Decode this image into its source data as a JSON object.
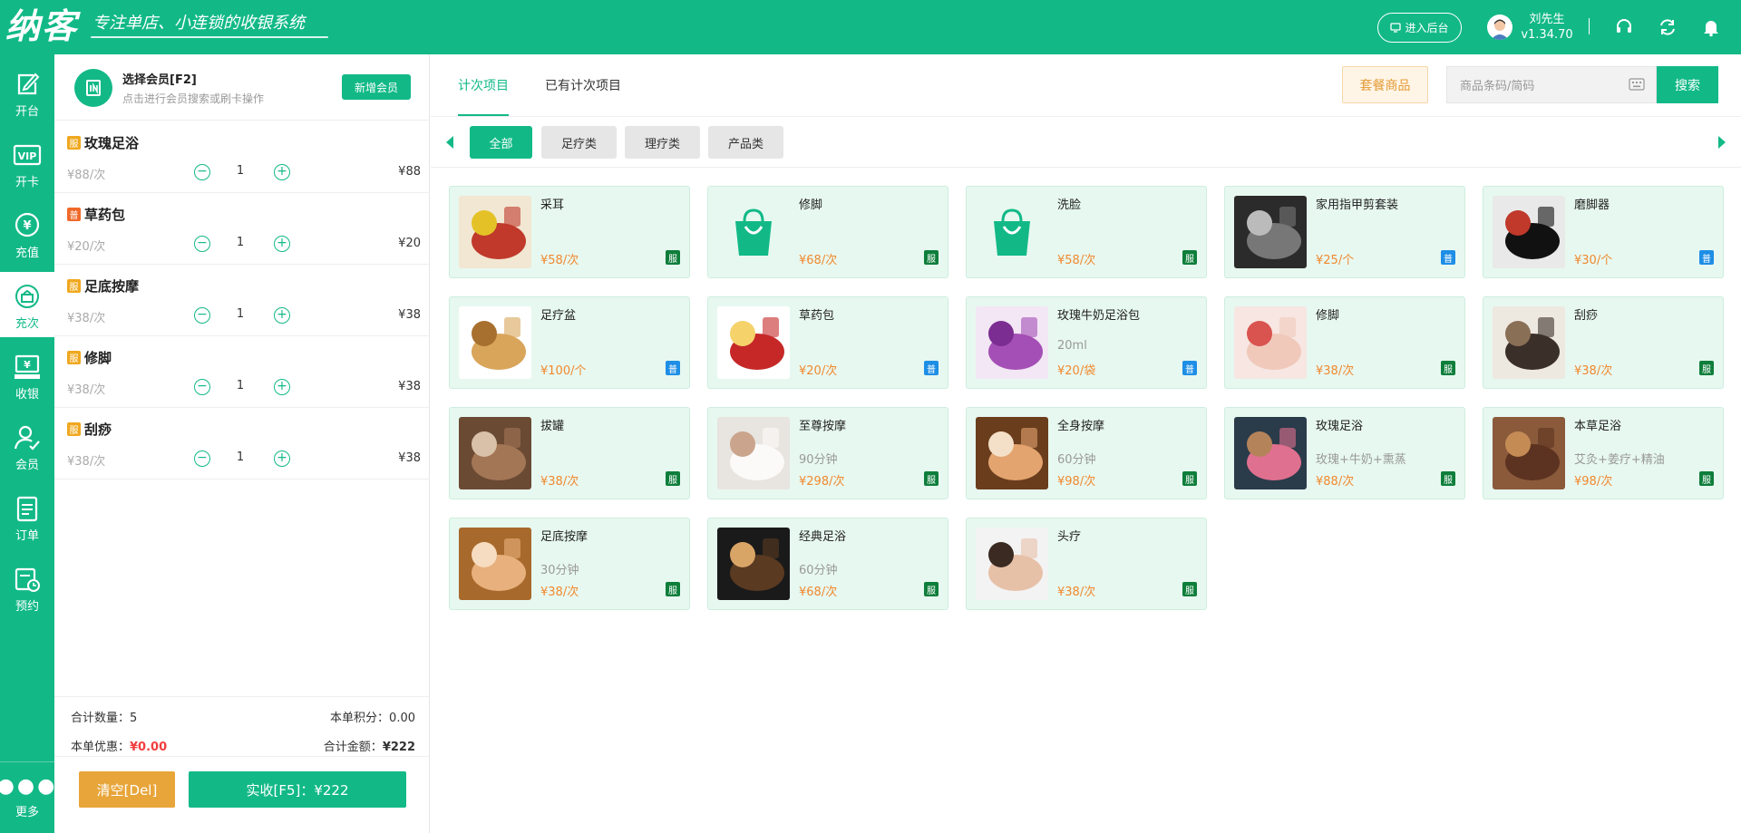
{
  "header": {
    "logo_text": "纳客",
    "slogan": "专注单店、小连锁的收银系统",
    "admin_label": "进入后台",
    "user_name": "刘先生",
    "version": "v1.34.70"
  },
  "nav": {
    "items": [
      {
        "label": "开台",
        "icon": "edit-icon"
      },
      {
        "label": "开卡",
        "icon": "vip-card-icon"
      },
      {
        "label": "充值",
        "icon": "yuan-coin-icon"
      },
      {
        "label": "充次",
        "icon": "gift-box-icon"
      },
      {
        "label": "收银",
        "icon": "cash-register-icon"
      },
      {
        "label": "会员",
        "icon": "user-check-icon"
      },
      {
        "label": "订单",
        "icon": "clipboard-icon"
      },
      {
        "label": "预约",
        "icon": "calendar-clock-icon"
      }
    ],
    "active_index": 3,
    "more_label": "更多"
  },
  "member": {
    "title": "选择会员[F2]",
    "subtitle": "点击进行会员搜索或刷卡操作",
    "add_label": "新增会员"
  },
  "cart": {
    "items": [
      {
        "badge": "服",
        "badge_color": "#f0a81f",
        "name": "玫瑰足浴",
        "unit_price": "¥88/次",
        "qty": "1",
        "total": "¥88"
      },
      {
        "badge": "普",
        "badge_color": "#f0692a",
        "name": "草药包",
        "unit_price": "¥20/次",
        "qty": "1",
        "total": "¥20"
      },
      {
        "badge": "服",
        "badge_color": "#f0a81f",
        "name": "足底按摩",
        "unit_price": "¥38/次",
        "qty": "1",
        "total": "¥38"
      },
      {
        "badge": "服",
        "badge_color": "#f0a81f",
        "name": "修脚",
        "unit_price": "¥38/次",
        "qty": "1",
        "total": "¥38"
      },
      {
        "badge": "服",
        "badge_color": "#f0a81f",
        "name": "刮痧",
        "unit_price": "¥38/次",
        "qty": "1",
        "total": "¥38"
      }
    ],
    "minus_symbol": "−",
    "plus_symbol": "+"
  },
  "summary": {
    "count_label": "合计数量：",
    "count_value": "5",
    "points_label": "本单积分：",
    "points_value": "0.00",
    "discount_label": "本单优惠：",
    "discount_value": "¥0.00",
    "total_label": "合计金额：",
    "total_value": "¥222"
  },
  "footer": {
    "clear_label": "清空[Del]",
    "pay_label": "实收[F5]：¥222"
  },
  "tabs": [
    "计次项目",
    "已有计次项目"
  ],
  "toolbar": {
    "package_label": "套餐商品",
    "search_placeholder": "商品条码/简码",
    "search_label": "搜索"
  },
  "categories": [
    "全部",
    "足疗类",
    "理疗类",
    "产品类"
  ],
  "products": [
    {
      "name": "采耳",
      "desc": "",
      "price": "¥58/次",
      "badge": "服",
      "thumb": "ear-cleaning-photo"
    },
    {
      "name": "修脚",
      "desc": "",
      "price": "¥68/次",
      "badge": "服",
      "thumb": "shopping-bag-icon"
    },
    {
      "name": "洗脸",
      "desc": "",
      "price": "¥58/次",
      "badge": "服",
      "thumb": "shopping-bag-icon"
    },
    {
      "name": "家用指甲剪套装",
      "desc": "",
      "price": "¥25/个",
      "badge": "普",
      "thumb": "nail-clipper-set-photo"
    },
    {
      "name": "磨脚器",
      "desc": "",
      "price": "¥30/个",
      "badge": "普",
      "thumb": "foot-file-photo"
    },
    {
      "name": "足疗盆",
      "desc": "",
      "price": "¥100/个",
      "badge": "普",
      "thumb": "wooden-basin-photo"
    },
    {
      "name": "草药包",
      "desc": "",
      "price": "¥20/次",
      "badge": "普",
      "thumb": "herbal-pack-photo"
    },
    {
      "name": "玫瑰牛奶足浴包",
      "desc": "20ml",
      "price": "¥20/袋",
      "badge": "普",
      "thumb": "rose-milk-pack-photo"
    },
    {
      "name": "修脚",
      "desc": "",
      "price": "¥38/次",
      "badge": "服",
      "thumb": "pedicure-photo"
    },
    {
      "name": "刮痧",
      "desc": "",
      "price": "¥38/次",
      "badge": "服",
      "thumb": "guasha-photo"
    },
    {
      "name": "拔罐",
      "desc": "",
      "price": "¥38/次",
      "badge": "服",
      "thumb": "cupping-photo"
    },
    {
      "name": "至尊按摩",
      "desc": "90分钟",
      "price": "¥298/次",
      "badge": "服",
      "thumb": "massage-photo"
    },
    {
      "name": "全身按摩",
      "desc": "60分钟",
      "price": "¥98/次",
      "badge": "服",
      "thumb": "body-massage-photo"
    },
    {
      "name": "玫瑰足浴",
      "desc": "玫瑰+牛奶+熏蒸",
      "price": "¥88/次",
      "badge": "服",
      "thumb": "rose-footbath-photo"
    },
    {
      "name": "本草足浴",
      "desc": "艾灸+姜疗+精油",
      "price": "¥98/次",
      "badge": "服",
      "thumb": "herbal-footbath-photo"
    },
    {
      "name": "足底按摩",
      "desc": "30分钟",
      "price": "¥38/次",
      "badge": "服",
      "thumb": "foot-massage-photo"
    },
    {
      "name": "经典足浴",
      "desc": "60分钟",
      "price": "¥68/次",
      "badge": "服",
      "thumb": "classic-footbath-photo"
    },
    {
      "name": "头疗",
      "desc": "",
      "price": "¥38/次",
      "badge": "服",
      "thumb": "head-therapy-photo"
    }
  ],
  "colors": {
    "brand": "#12b987",
    "service_badge": "#0e7e3b",
    "goods_badge": "#1e8ee6",
    "price": "#f0892f"
  }
}
